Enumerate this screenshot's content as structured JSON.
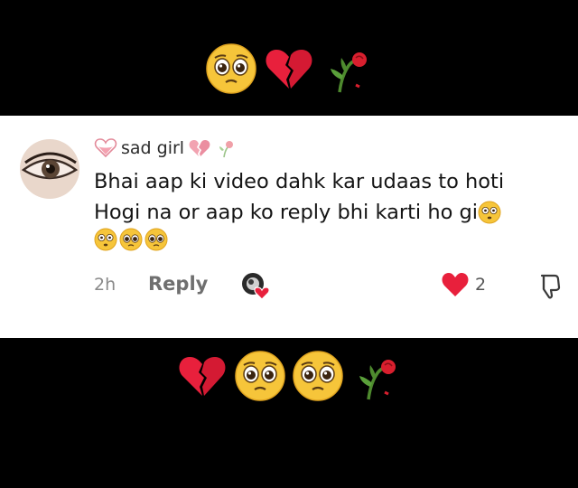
{
  "header_emojis": [
    {
      "icon": "pleading-face-icon"
    },
    {
      "icon": "broken-heart-icon"
    },
    {
      "icon": "wilted-rose-icon"
    }
  ],
  "comment": {
    "username": "sad girl",
    "text_line1": "Bhai aap ki video dahk kar udaas to hoti",
    "text_line2": "Hogi na or aap ko reply bhi karti ho gi",
    "trailing_emojis": [
      "flushed-face-icon",
      "pleading-face-icon",
      "pleading-face-icon"
    ],
    "time": "2h",
    "reply_label": "Reply",
    "like_count": "2",
    "colors": {
      "like": "#e8203c",
      "text": "#151515",
      "muted": "#8a8a8a"
    }
  },
  "footer_emojis": [
    {
      "icon": "broken-heart-icon"
    },
    {
      "icon": "pleading-face-icon"
    },
    {
      "icon": "pleading-face-icon"
    },
    {
      "icon": "wilted-rose-icon"
    }
  ]
}
